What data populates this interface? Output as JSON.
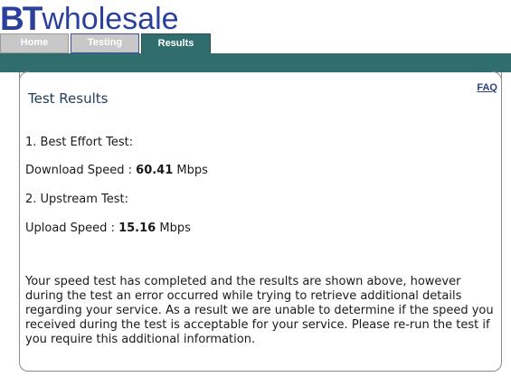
{
  "logo": {
    "brand": "BT",
    "product": "wholesale"
  },
  "tabs": {
    "home": "Home",
    "testing": "Testing",
    "results": "Results"
  },
  "panel": {
    "faq_link": "FAQ",
    "title": "Test Results",
    "best_effort_heading": "1. Best Effort Test:",
    "download_label": "Download Speed :",
    "download_value": "60.41",
    "download_unit": "Mbps",
    "upstream_heading": "2. Upstream Test:",
    "upload_label": "Upload Speed :",
    "upload_value": "15.16",
    "upload_unit": "Mbps",
    "message": "Your speed test has completed and the results are shown above, however during the test an error occurred while trying to retrieve additional details regarding your service. As a result we are unable to determine if the speed you received during the test is acceptable for your service. Please re-run the test if you require this additional information."
  },
  "colors": {
    "brand_blue": "#2b3f9c",
    "tab_green": "#2f6e6c",
    "tab_grey": "#c8c8c8"
  }
}
